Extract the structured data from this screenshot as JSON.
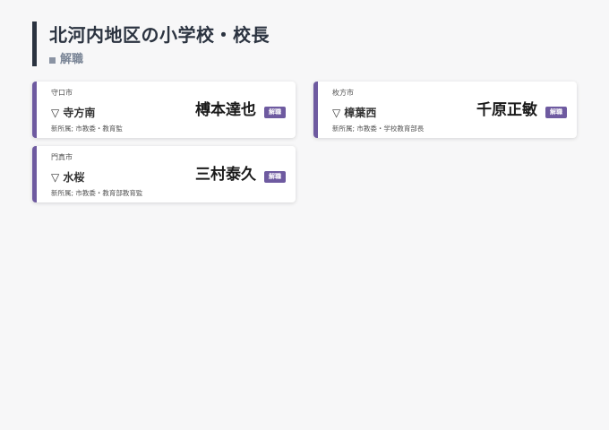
{
  "page": {
    "title": "北河内地区の小学校・校長",
    "subtitle": "解職"
  },
  "colors": {
    "accent": "#6e5aa0",
    "header_bar": "#2b3340",
    "background": "#f7f7f8"
  },
  "cards": [
    {
      "city": "守口市",
      "school": "▽ 寺方南",
      "person": "榑本達也",
      "badge": "解職",
      "new_post": "新所属; 市教委・教育監"
    },
    {
      "city": "枚方市",
      "school": "▽ 樟葉西",
      "person": "千原正敏",
      "badge": "解職",
      "new_post": "新所属; 市教委・学校教育部長"
    },
    {
      "city": "門真市",
      "school": "▽ 水桜",
      "person": "三村泰久",
      "badge": "解職",
      "new_post": "新所属; 市教委・教育部教育監"
    }
  ]
}
